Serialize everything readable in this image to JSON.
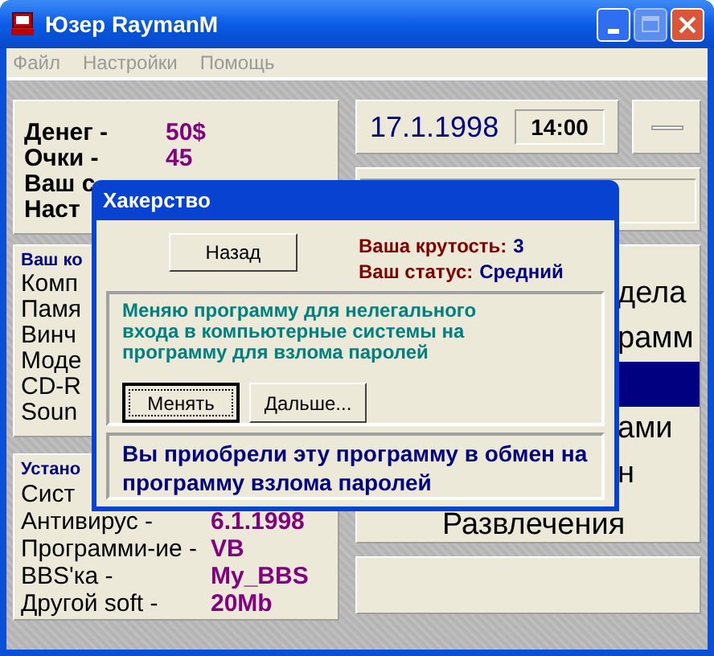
{
  "window": {
    "title": "Юзер RaymanM"
  },
  "menu": [
    "Файл",
    "Настройки",
    "Помощь"
  ],
  "stats": [
    {
      "label": "Денег -",
      "value": "50$"
    },
    {
      "label": "Очки -",
      "value": "45"
    },
    {
      "label": "Ваш с"
    },
    {
      "label": "Наст"
    }
  ],
  "computer": {
    "legend": "Ваш ко",
    "items": [
      "Комп",
      "Памя",
      "Винч",
      "Моде",
      "CD-R",
      "Soun"
    ]
  },
  "software": {
    "legend": "Устано",
    "rows": [
      {
        "label": "Сист"
      },
      {
        "label": "Антивирус -",
        "value": "6.1.1998"
      },
      {
        "label": "Программи-ие -",
        "value": "VB"
      },
      {
        "label": "BBS'ка -",
        "value": "My_BBS"
      },
      {
        "label": "Другой soft -",
        "value": "20Mb"
      }
    ]
  },
  "clock": {
    "date": "17.1.1998",
    "time": "14:00"
  },
  "sections": [
    {
      "label": "дела",
      "selected": false
    },
    {
      "label": "рамм",
      "selected": false
    },
    {
      "selected": true
    },
    {
      "label": "ами",
      "selected": false
    },
    {
      "label": "н",
      "selected": false
    },
    {
      "label": "Развлечения",
      "selected": false
    }
  ],
  "dialog": {
    "title": "Хакерство",
    "back_button": "Назад",
    "coolness_label": "Ваша крутость:",
    "coolness": "3",
    "status_label": "Ваш статус:",
    "status": "Средний",
    "offer": "Меняю программу для нелегального входа в компьютерные системы на программу для взлома паролей",
    "buttons": [
      {
        "label": "Менять",
        "focused": true
      },
      {
        "label": "Дальше...",
        "focused": false
      }
    ],
    "message": "Вы приобрели эту программу в обмен на программу взлома паролей"
  }
}
